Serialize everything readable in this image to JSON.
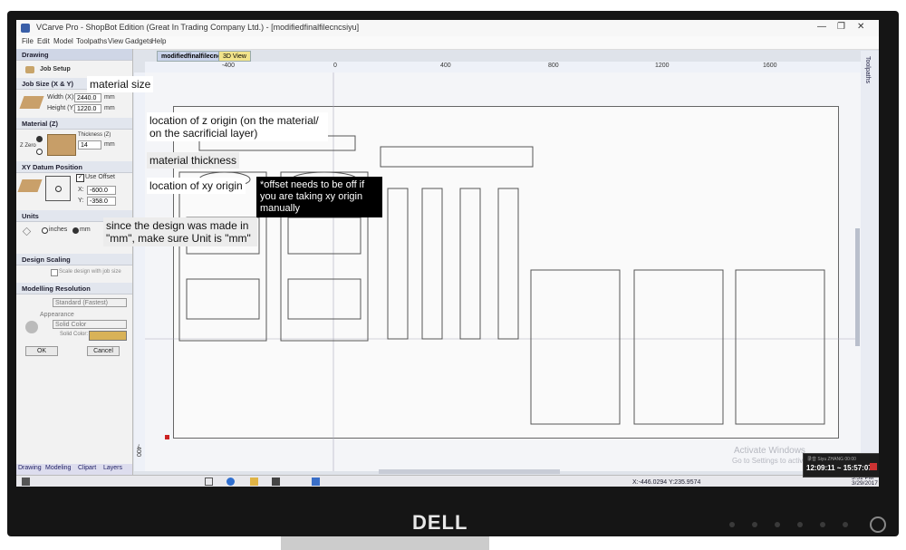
{
  "window": {
    "title": "VCarve Pro - ShopBot Edition (Great In Trading Company Ltd.) - [modifiedfinalfilecncsiyu]"
  },
  "menu": [
    "File",
    "Edit",
    "Model",
    "Toolpaths",
    "View",
    "Gadgets",
    "Help"
  ],
  "panel": {
    "header": "Drawing",
    "job_setup": "Job Setup",
    "job_size_title": "Job Size (X & Y)",
    "width_label": "Width (X):",
    "width_value": "2440.0",
    "height_label": "Height (Y):",
    "height_value": "1220.0",
    "unit_mm": "mm",
    "material_title": "Material (Z)",
    "thickness_label": "Thickness (Z)",
    "thickness_value": "14",
    "z_zero": "Z Zero",
    "xy_title": "XY Datum Position",
    "use_offset": "Use Offset",
    "x_label": "X:",
    "x_value": "-600.0",
    "y_label": "Y:",
    "y_value": "-358.0",
    "units_title": "Units",
    "units_inches": "inches",
    "units_mm": "mm",
    "scaling_title": "Design Scaling",
    "scaling_check": "Scale design with job size",
    "resolution_title": "Modelling Resolution",
    "resolution_value": "Standard (Fastest)",
    "appearance_title": "Appearance",
    "appearance_value": "Solid Color",
    "solid_color_label": "Solid Color:",
    "ok_button": "OK",
    "cancel_button": "Cancel",
    "bottom_tabs": [
      "Drawing",
      "Modeling",
      "Clipart",
      "Layers"
    ]
  },
  "doc_tabs": [
    "modifiedfinalfilecncsiyu",
    "3D View"
  ],
  "ruler_h": [
    "-400",
    "0",
    "400",
    "800",
    "1200",
    "1600"
  ],
  "ruler_v": [
    "-400"
  ],
  "side_tab": "Toolpaths",
  "annotations": {
    "material_size": "material size",
    "z_origin": "location of z origin (on the material/ on the sacrificial layer)",
    "material_thickness": "material thickness",
    "xy_origin": "location of xy origin",
    "offset_note": "*offset needs to be off if you are taking xy origin manually",
    "units_note": "since the design was made in \"mm\", make sure Unit is \"mm\""
  },
  "watermark": {
    "line1": "Activate Windows",
    "line2": "Go to Settings to activate Windows."
  },
  "status": {
    "coords": "X:-446.0294 Y:235.9574"
  },
  "timer": {
    "label": "录音 Siyu ZHANG 00:00",
    "range": "12:09:11 ~ 15:57:07"
  },
  "clock": {
    "time": "3:51 PM",
    "date": "3/29/2017"
  },
  "brand": "DELL",
  "colors": {
    "origin_marker": "#cc2222",
    "timer_close": "#cc3333"
  }
}
